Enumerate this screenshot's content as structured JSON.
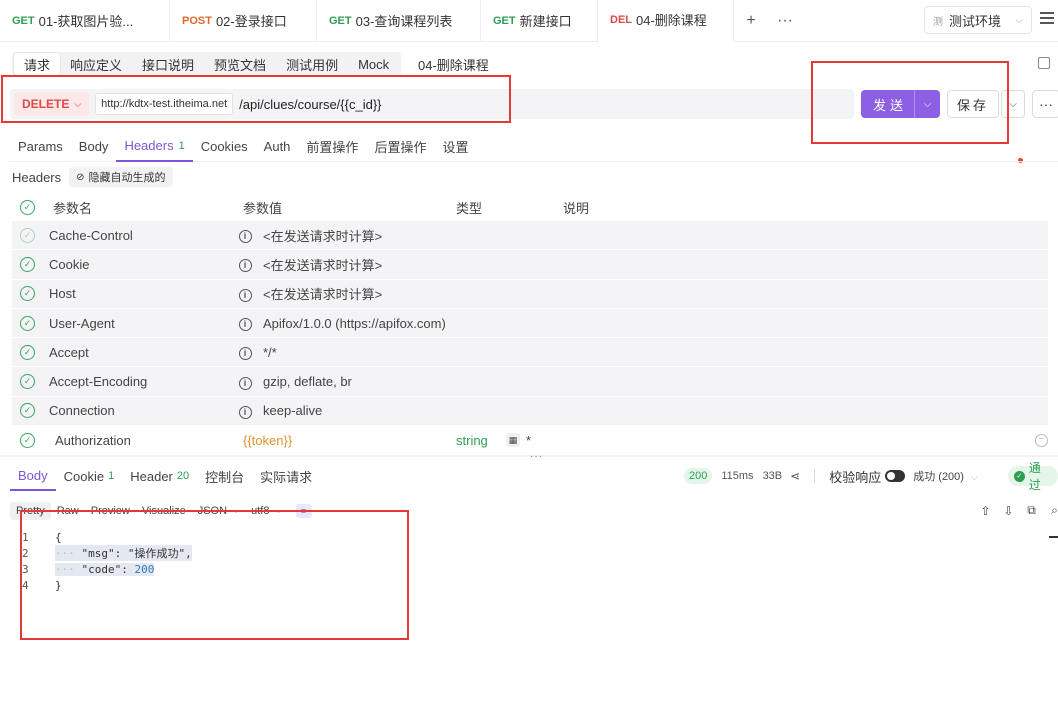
{
  "tabs": [
    {
      "method": "GET",
      "label": "01-获取图片验..."
    },
    {
      "method": "POST",
      "label": "02-登录接口"
    },
    {
      "method": "GET",
      "label": "03-查询课程列表"
    },
    {
      "method": "GET",
      "label": "新建接口"
    },
    {
      "method": "DEL",
      "label": "04-删除课程"
    }
  ],
  "tab_actions": {
    "add": "+",
    "more": "···"
  },
  "environment": {
    "badge": "测",
    "label": "测试环境"
  },
  "subtabs": [
    "请求",
    "响应定义",
    "接口说明",
    "预览文档",
    "测试用例",
    "Mock"
  ],
  "api_title": "04-删除课程",
  "request": {
    "method": "DELETE",
    "base_url": "http://kdtx-test.itheima.net",
    "path": "/api/clues/course/{{c_id}}",
    "send_label": "发送",
    "save_label": "保存"
  },
  "request_tabs": [
    {
      "label": "Params"
    },
    {
      "label": "Body"
    },
    {
      "label": "Headers",
      "count": "1"
    },
    {
      "label": "Cookies"
    },
    {
      "label": "Auth"
    },
    {
      "label": "前置操作"
    },
    {
      "label": "后置操作"
    },
    {
      "label": "设置"
    }
  ],
  "headers_section": {
    "label": "Headers",
    "hide_auto_label": "隐藏自动生成的"
  },
  "table": {
    "columns": [
      "参数名",
      "参数值",
      "类型",
      "说明"
    ],
    "auto_rows": [
      {
        "name": "Cache-Control",
        "value": "<在发送请求时计算>"
      },
      {
        "name": "Cookie",
        "value": "<在发送请求时计算>"
      },
      {
        "name": "Host",
        "value": "<在发送请求时计算>"
      },
      {
        "name": "User-Agent",
        "value": "Apifox/1.0.0 (https://apifox.com)"
      },
      {
        "name": "Accept",
        "value": "*/*"
      },
      {
        "name": "Accept-Encoding",
        "value": "gzip, deflate, br"
      },
      {
        "name": "Connection",
        "value": "keep-alive"
      }
    ],
    "custom_row": {
      "name": "Authorization",
      "value": "{{token}}",
      "type": "string",
      "star": "*"
    }
  },
  "response_tabs": [
    {
      "label": "Body"
    },
    {
      "label": "Cookie",
      "count": "1"
    },
    {
      "label": "Header",
      "count": "20"
    },
    {
      "label": "控制台"
    },
    {
      "label": "实际请求"
    }
  ],
  "response_meta": {
    "status": "200",
    "time": "115ms",
    "size": "33B",
    "validate_label": "校验响应",
    "success_label": "成功 (200)",
    "pass_label": "通过"
  },
  "view_modes": [
    "Pretty",
    "Raw",
    "Preview",
    "Visualize"
  ],
  "format": "JSON",
  "encoding": "utf8",
  "code_lines": [
    {
      "n": "1",
      "text": "{"
    },
    {
      "n": "2",
      "key": "\"msg\"",
      "val": "\"操作成功\"",
      "tail": ","
    },
    {
      "n": "3",
      "key": "\"code\"",
      "val": "200",
      "tail": ""
    },
    {
      "n": "4",
      "text": "}"
    }
  ]
}
